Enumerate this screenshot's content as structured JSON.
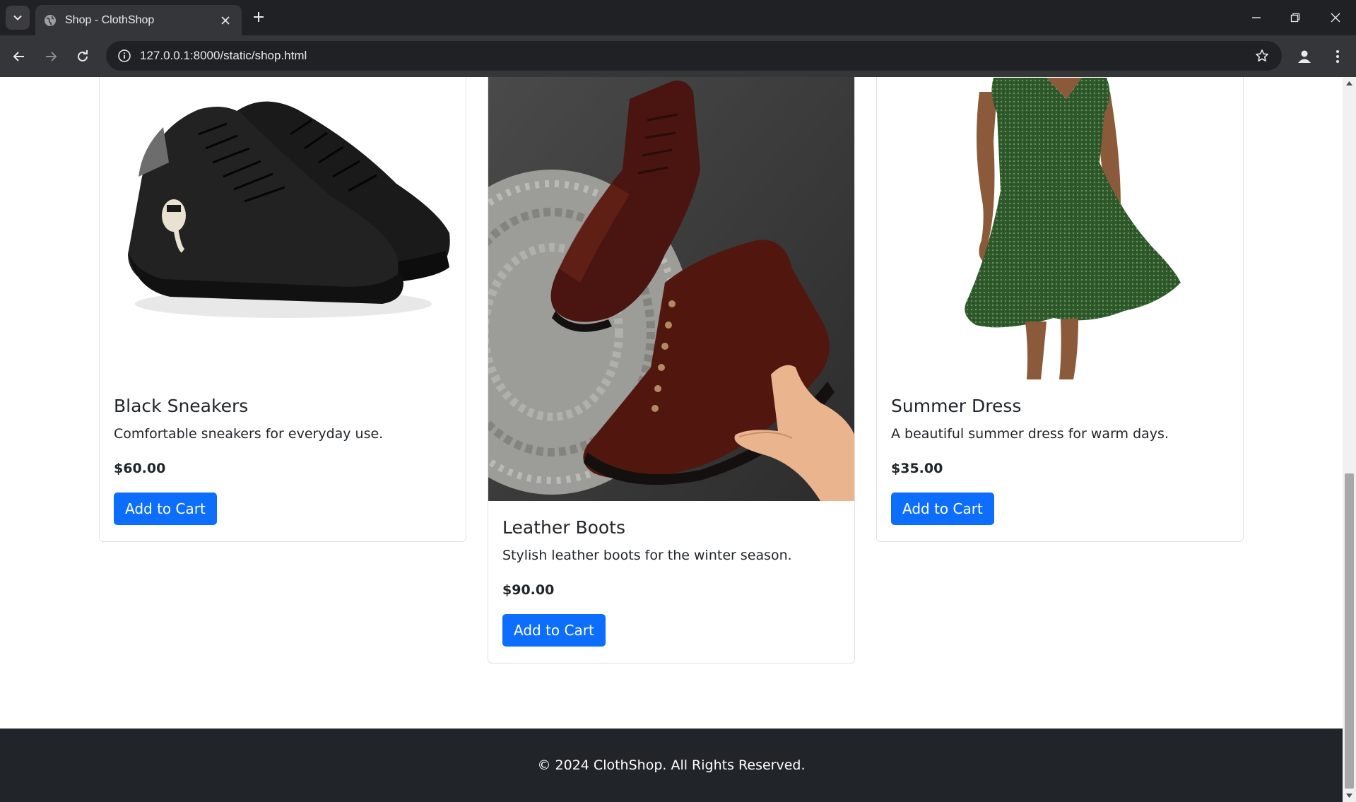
{
  "browser": {
    "tab_title": "Shop - ClothShop",
    "url": "127.0.0.1:8000/static/shop.html",
    "icons": {
      "tab_search": "chevron-down-icon",
      "favicon": "globe-icon",
      "tab_close": "close-icon",
      "new_tab": "plus-icon",
      "minimize": "minimize-icon",
      "restore": "restore-icon",
      "close": "close-icon",
      "back": "arrow-left-icon",
      "forward": "arrow-right-icon",
      "reload": "reload-icon",
      "site_info": "info-icon",
      "bookmark": "star-icon",
      "profile": "profile-icon",
      "menu": "more-vertical-icon"
    }
  },
  "products": [
    {
      "name": "Black Sneakers",
      "description": "Comfortable sneakers for everyday use.",
      "price": "$60.00",
      "button_label": "Add to Cart"
    },
    {
      "name": "Leather Boots",
      "description": "Stylish leather boots for the winter season.",
      "price": "$90.00",
      "button_label": "Add to Cart"
    },
    {
      "name": "Summer Dress",
      "description": "A beautiful summer dress for warm days.",
      "price": "$35.00",
      "button_label": "Add to Cart"
    }
  ],
  "footer": {
    "text": "© 2024 ClothShop. All Rights Reserved."
  },
  "colors": {
    "primary_button": "#0d6efd",
    "footer_bg": "#212529",
    "chrome_dark": "#202124",
    "chrome_toolbar": "#35363a"
  }
}
